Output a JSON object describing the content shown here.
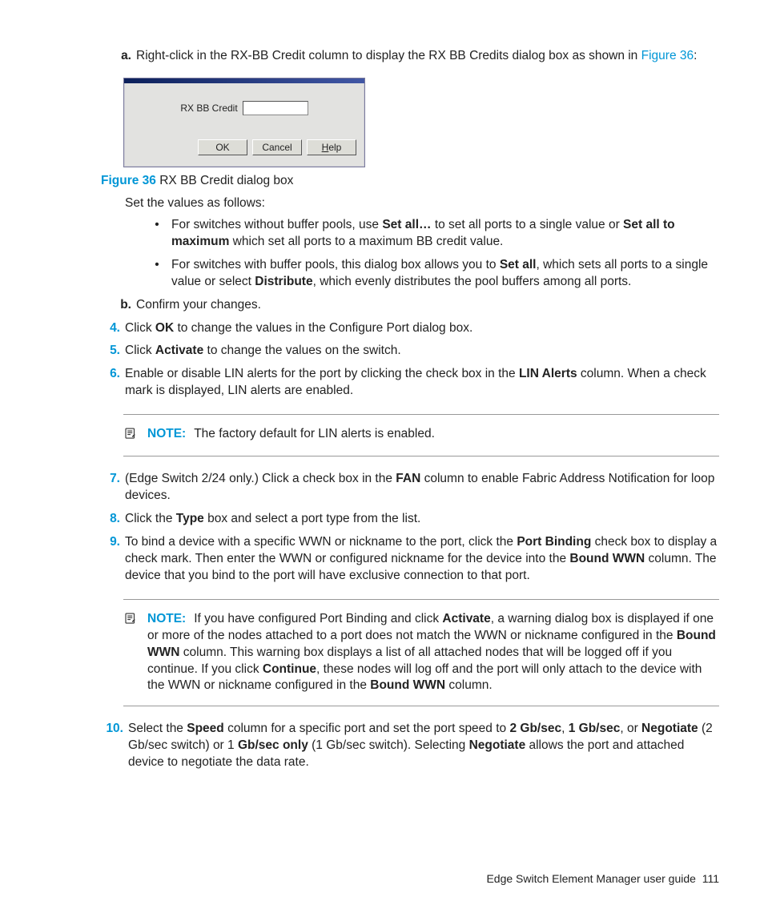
{
  "steps": {
    "a": {
      "marker": "a.",
      "text_before": "Right-click in the RX-BB Credit column to display the RX BB Credits dialog box as shown in ",
      "figref": "Figure 36",
      "text_after": ":"
    },
    "set_intro": "Set the values as follows:",
    "bullet1": {
      "pre": "For switches without buffer pools, use ",
      "b1": "Set all…",
      "mid": " to set all ports to a single value or ",
      "b2": "Set all to maximum",
      "post": " which set all ports to a maximum BB credit value."
    },
    "bullet2": {
      "pre": "For switches with buffer pools, this dialog box allows you to ",
      "b1": "Set all",
      "mid": ", which sets all ports to a single value or select ",
      "b2": "Distribute",
      "post": ", which evenly distributes the pool buffers among all ports."
    },
    "b": {
      "marker": "b.",
      "text": "Confirm your changes."
    },
    "s4": {
      "marker": "4.",
      "pre": "Click ",
      "b1": "OK",
      "post": " to change the values in the Configure Port dialog box."
    },
    "s5": {
      "marker": "5.",
      "pre": "Click ",
      "b1": "Activate",
      "post": " to change the values on the switch."
    },
    "s6": {
      "marker": "6.",
      "pre": "Enable or disable LIN alerts for the port by clicking the check box in the ",
      "b1": "LIN Alerts",
      "post": " column. When a check mark is displayed, LIN alerts are enabled."
    },
    "s7": {
      "marker": "7.",
      "pre": "(Edge Switch 2/24 only.) Click a check box in the ",
      "b1": "FAN",
      "post": " column to enable Fabric Address Notification for loop devices."
    },
    "s8": {
      "marker": "8.",
      "pre": "Click the ",
      "b1": "Type",
      "post": " box and select a port type from the list."
    },
    "s9": {
      "marker": "9.",
      "pre": "To bind a device with a specific WWN or nickname to the port, click the ",
      "b1": "Port Binding",
      "mid": " check box to display a check mark. Then enter the WWN or configured nickname for the device into the ",
      "b2": "Bound WWN",
      "post": " column. The device that you bind to the port will have exclusive connection to that port."
    },
    "s10": {
      "marker": "10.",
      "pre": "Select the ",
      "b1": "Speed",
      "mid1": " column for a specific port and set the port speed to ",
      "b2": "2 Gb/sec",
      "comma1": ", ",
      "b3": "1 Gb/sec",
      "mid2": ", or ",
      "b4": "Negotiate",
      "mid3": " (2 Gb/sec switch) or 1 ",
      "b5": "Gb/sec only",
      "mid4": " (1 Gb/sec switch). Selecting ",
      "b6": "Negotiate",
      "post": " allows the port and attached device to negotiate the data rate."
    }
  },
  "dialog": {
    "field_label": "RX BB Credit",
    "ok": "OK",
    "cancel": "Cancel",
    "help": "Help"
  },
  "figure": {
    "label": "Figure 36",
    "caption": " RX BB Credit dialog box"
  },
  "note1": {
    "label": "NOTE:",
    "text": "The factory default for LIN alerts is enabled."
  },
  "note2": {
    "label": "NOTE:",
    "pre": "If you have configured Port Binding and click ",
    "b1": "Activate",
    "mid1": ", a warning dialog box is displayed if one or more of the nodes attached to a port does not match the WWN or nickname configured in the ",
    "b2": "Bound WWN",
    "mid2": " column. This warning box displays a list of all attached nodes that will be logged off if you continue. If you click ",
    "b3": "Continue",
    "mid3": ", these nodes will log off and the port will only attach to the device with the WWN or nickname configured in the ",
    "b4": "Bound WWN",
    "post": " column."
  },
  "footer": {
    "title": "Edge Switch Element Manager user guide",
    "page": "111"
  }
}
